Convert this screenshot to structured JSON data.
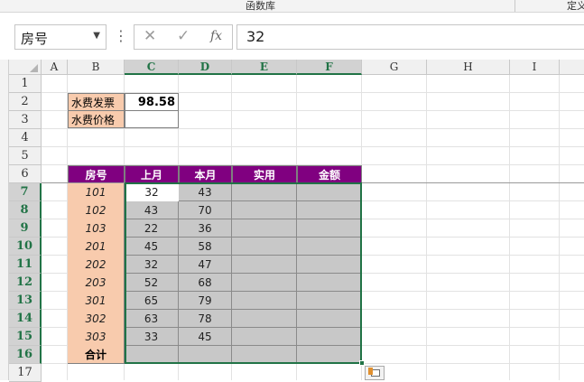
{
  "ribbon": {
    "group_label": "函数库",
    "right_label": "定义"
  },
  "formula_bar": {
    "name_box": "房号",
    "cancel_glyph": "✕",
    "enter_glyph": "✓",
    "fx_glyph": "fx",
    "formula": "32"
  },
  "columns": [
    "A",
    "B",
    "C",
    "D",
    "E",
    "F",
    "G",
    "H",
    "I"
  ],
  "rows": [
    "1",
    "2",
    "3",
    "4",
    "5",
    "6",
    "7",
    "8",
    "9",
    "10",
    "11",
    "12",
    "13",
    "14",
    "15",
    "16",
    "17"
  ],
  "info_table": {
    "invoice_label": "水费发票",
    "invoice_value": "98.58",
    "price_label": "水费价格",
    "price_value": ""
  },
  "main_table": {
    "headers": [
      "房号",
      "上月",
      "本月",
      "实用",
      "金额"
    ],
    "rows": [
      {
        "room": "101",
        "last": "32",
        "this": "43",
        "used": "",
        "amount": ""
      },
      {
        "room": "102",
        "last": "43",
        "this": "70",
        "used": "",
        "amount": ""
      },
      {
        "room": "103",
        "last": "22",
        "this": "36",
        "used": "",
        "amount": ""
      },
      {
        "room": "201",
        "last": "45",
        "this": "58",
        "used": "",
        "amount": ""
      },
      {
        "room": "202",
        "last": "32",
        "this": "47",
        "used": "",
        "amount": ""
      },
      {
        "room": "203",
        "last": "52",
        "this": "68",
        "used": "",
        "amount": ""
      },
      {
        "room": "301",
        "last": "65",
        "this": "79",
        "used": "",
        "amount": ""
      },
      {
        "room": "302",
        "last": "63",
        "this": "78",
        "used": "",
        "amount": ""
      },
      {
        "room": "303",
        "last": "33",
        "this": "45",
        "used": "",
        "amount": ""
      }
    ],
    "total_label": "合计"
  },
  "colors": {
    "header_purple": "#800080",
    "label_peach": "#f8cbad",
    "selection_grey": "#c8c8c8",
    "excel_green": "#217346"
  }
}
